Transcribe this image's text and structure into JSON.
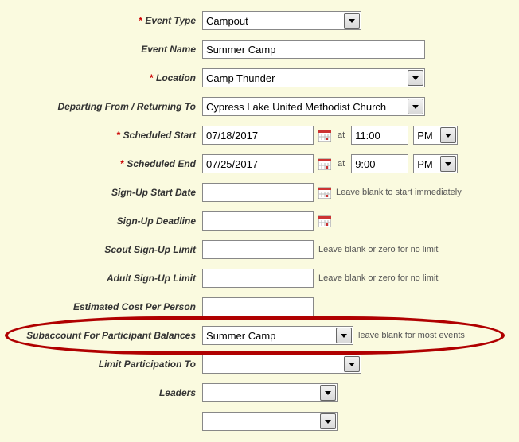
{
  "labels": {
    "event_type": "Event Type",
    "event_name": "Event Name",
    "location": "Location",
    "departing": "Departing From / Returning To",
    "sched_start": "Scheduled Start",
    "sched_end": "Scheduled End",
    "signup_start": "Sign-Up Start Date",
    "signup_deadline": "Sign-Up Deadline",
    "scout_limit": "Scout Sign-Up Limit",
    "adult_limit": "Adult Sign-Up Limit",
    "est_cost": "Estimated Cost Per Person",
    "subaccount": "Subaccount For Participant Balances",
    "limit_to": "Limit Participation To",
    "leaders": "Leaders"
  },
  "values": {
    "event_type": "Campout",
    "event_name": "Summer Camp",
    "location": "Camp Thunder",
    "departing": "Cypress Lake United Methodist Church",
    "sched_start_date": "07/18/2017",
    "sched_start_time": "11:00",
    "sched_start_ampm": "PM",
    "sched_end_date": "07/25/2017",
    "sched_end_time": "9:00",
    "sched_end_ampm": "PM",
    "signup_start": "",
    "signup_deadline": "",
    "scout_limit": "",
    "adult_limit": "",
    "est_cost": "",
    "subaccount": "Summer Camp",
    "limit_to": "",
    "leaders1": "",
    "leaders2": ""
  },
  "hints": {
    "at": "at",
    "signup_start": "Leave blank to start immediately",
    "limit": "Leave blank or zero for no limit",
    "subaccount": "leave blank for most events"
  }
}
